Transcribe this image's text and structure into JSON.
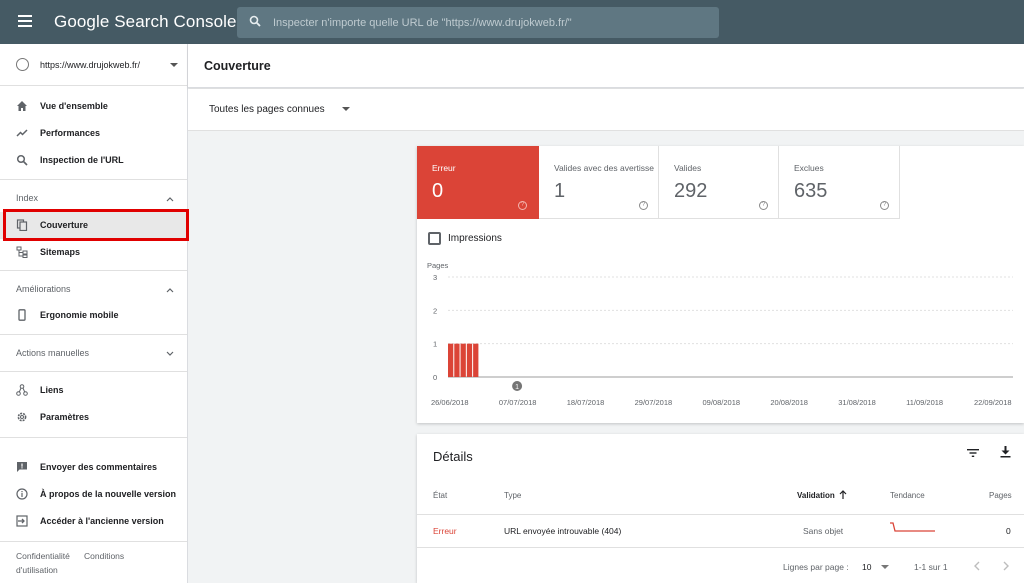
{
  "app": {
    "title": "Google Search Console"
  },
  "search": {
    "placeholder": "Inspecter n'importe quelle URL de \"https://www.drujokweb.fr/\""
  },
  "property": {
    "label": "https://www.drujokweb.fr/"
  },
  "nav": {
    "top": [
      {
        "label": "Vue d'ensemble",
        "icon": "home-icon"
      },
      {
        "label": "Performances",
        "icon": "trending-up-icon"
      },
      {
        "label": "Inspection de l'URL",
        "icon": "search-icon"
      }
    ],
    "index_title": "Index",
    "index": [
      {
        "label": "Couverture",
        "icon": "copy-icon",
        "active": true
      },
      {
        "label": "Sitemaps",
        "icon": "sitemap-icon"
      }
    ],
    "improvements_title": "Améliorations",
    "improvements": [
      {
        "label": "Ergonomie mobile",
        "icon": "phone-icon"
      }
    ],
    "manual_title": "Actions manuelles",
    "bottom": [
      {
        "label": "Liens",
        "icon": "links-icon"
      },
      {
        "label": "Paramètres",
        "icon": "gear-icon"
      }
    ],
    "footer": [
      {
        "label": "Envoyer des commentaires",
        "icon": "feedback-icon"
      },
      {
        "label": "À propos de la nouvelle version",
        "icon": "info-icon"
      },
      {
        "label": "Accéder à l'ancienne version",
        "icon": "exit-icon"
      }
    ],
    "links": {
      "privacy": "Confidentialité",
      "terms": "Conditions",
      "terms2": "d'utilisation"
    }
  },
  "header": {
    "title": "Couverture"
  },
  "filter": {
    "label": "Toutes les pages connues"
  },
  "tiles": [
    {
      "label": "Erreur",
      "value": "0"
    },
    {
      "label": "Valides avec des avertissements",
      "value": "1"
    },
    {
      "label": "Valides",
      "value": "292"
    },
    {
      "label": "Exclues",
      "value": "635"
    }
  ],
  "impressions": {
    "label": "Impressions"
  },
  "chart_data": {
    "type": "bar",
    "ylabel": "Pages",
    "ylim": [
      0,
      3
    ],
    "yticks": [
      0,
      1,
      2,
      3
    ],
    "xticks": [
      "26/06/2018",
      "07/07/2018",
      "18/07/2018",
      "29/07/2018",
      "09/08/2018",
      "20/08/2018",
      "31/08/2018",
      "11/09/2018",
      "22/09/2018"
    ],
    "x_range_days": 89,
    "bars": [
      {
        "day": 0,
        "value": 1
      },
      {
        "day": 1,
        "value": 1
      },
      {
        "day": 2,
        "value": 1
      },
      {
        "day": 3,
        "value": 1
      },
      {
        "day": 4,
        "value": 1
      }
    ],
    "annotation": {
      "label": "1",
      "day": 11
    },
    "color": "#db4437",
    "grid": true
  },
  "details": {
    "title": "Détails",
    "headers": {
      "state": "État",
      "type": "Type",
      "validation": "Validation",
      "trend": "Tendance",
      "pages": "Pages"
    },
    "rows": [
      {
        "state": "Erreur",
        "type": "URL envoyée introuvable (404)",
        "validation": "Sans objet",
        "pages": "0"
      }
    ],
    "pager": {
      "rows_label": "Lignes par page :",
      "rows_value": "10",
      "range": "1-1 sur 1"
    }
  },
  "colors": {
    "topbar": "#455a64",
    "error": "#db4437",
    "highlight": "#e00000"
  }
}
